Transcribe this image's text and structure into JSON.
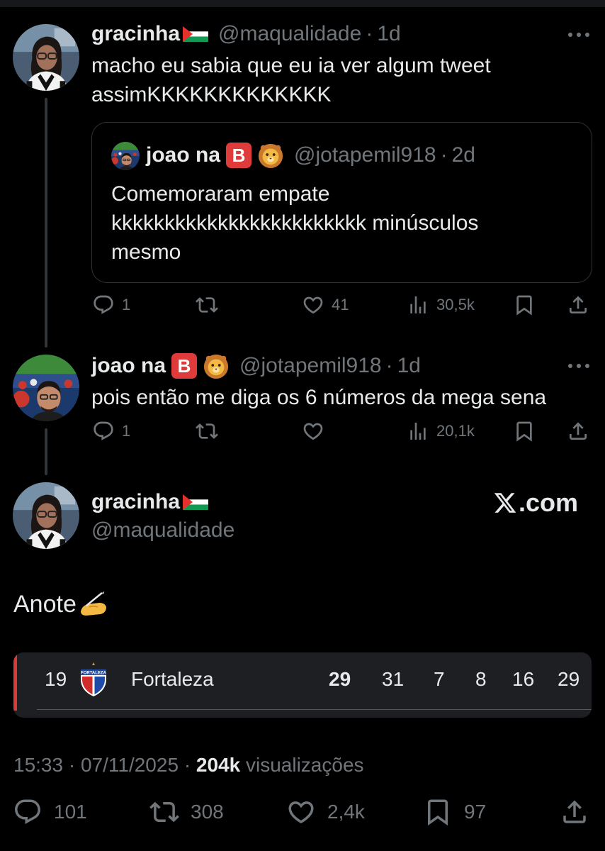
{
  "tweets": [
    {
      "name": "gracinha",
      "handle": "@maqualidade",
      "time": "1d",
      "text_line1": "macho eu sabia que eu ia ver algum tweet",
      "text_line2": "assimKKKKKKKKKKKKK",
      "quote": {
        "name": "joao na",
        "badge": "B",
        "handle": "@jotapemil918",
        "time": "2d",
        "text_line1": "Comemoraram empate",
        "text_line2": "kkkkkkkkkkkkkkkkkkkkkkkk minúsculos",
        "text_line3": "mesmo"
      },
      "actions": {
        "replies": "1",
        "retweets": "",
        "likes": "41",
        "views": "30,5k"
      }
    },
    {
      "name": "joao na",
      "badge": "B",
      "handle": "@jotapemil918",
      "time": "1d",
      "text": "pois então me diga os 6 números da mega sena",
      "actions": {
        "replies": "1",
        "retweets": "",
        "likes": "",
        "views": "20,1k"
      }
    }
  ],
  "main_tweet": {
    "name": "gracinha",
    "handle": "@maqualidade",
    "watermark": ".com",
    "text": "Anote",
    "standings_row": {
      "position": "19",
      "team": "Fortaleza",
      "crest_label": "FORTALEZA",
      "points": "29",
      "played": "31",
      "wins": "7",
      "draws": "8",
      "losses": "16",
      "goals": "29"
    },
    "time": "15:33",
    "date": "07/11/2025",
    "views": "204k",
    "views_label": "visualizações",
    "actions": {
      "replies": "101",
      "retweets": "308",
      "likes": "2,4k",
      "bookmarks": "97"
    }
  },
  "colors": {
    "background": "#000000",
    "text": "#e7e9ea",
    "muted": "#71767b",
    "accent_red": "#d93a3a"
  },
  "icons": [
    "reply-icon",
    "retweet-icon",
    "like-icon",
    "views-icon",
    "bookmark-icon",
    "share-icon",
    "more-icon",
    "x-logo-icon",
    "palestine-flag-icon",
    "lion-emoji-icon",
    "writing-hand-emoji-icon"
  ]
}
